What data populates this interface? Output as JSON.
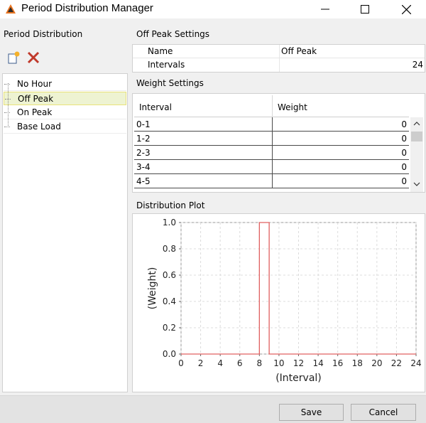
{
  "window": {
    "title": "Period Distribution Manager",
    "controls": [
      "minimize-icon",
      "maximize-icon",
      "close-icon"
    ]
  },
  "left": {
    "section_title": "Period Distribution",
    "toolbar": {
      "add_icon": "new-item-icon",
      "delete_icon": "delete-icon"
    },
    "items": [
      {
        "label": "No Hour",
        "selected": false
      },
      {
        "label": "Off Peak",
        "selected": true
      },
      {
        "label": "On Peak",
        "selected": false
      },
      {
        "label": "Base Load",
        "selected": false
      }
    ]
  },
  "settings": {
    "section_title": "Off Peak Settings",
    "rows": [
      {
        "key": "Name",
        "value": "Off Peak"
      },
      {
        "key": "Intervals",
        "value": "24"
      }
    ]
  },
  "weights": {
    "section_title": "Weight Settings",
    "columns": [
      "Interval",
      "Weight"
    ],
    "rows": [
      {
        "interval": "0-1",
        "weight": "0"
      },
      {
        "interval": "1-2",
        "weight": "0"
      },
      {
        "interval": "2-3",
        "weight": "0"
      },
      {
        "interval": "3-4",
        "weight": "0"
      },
      {
        "interval": "4-5",
        "weight": "0"
      }
    ]
  },
  "plot": {
    "section_title": "Distribution Plot",
    "colors": {
      "series": "#e06060",
      "grid": "#dcdcdc"
    }
  },
  "chart_data": {
    "type": "line",
    "xlabel": "(Interval)",
    "ylabel": "(Weight)",
    "xlim": [
      0,
      24
    ],
    "ylim": [
      0,
      1.0
    ],
    "xticks": [
      0,
      2,
      4,
      6,
      8,
      10,
      12,
      14,
      16,
      18,
      20,
      22,
      24
    ],
    "yticks": [
      0.0,
      0.2,
      0.4,
      0.6,
      0.8,
      1.0
    ],
    "ytick_labels": [
      "0.0",
      "0.2",
      "0.4",
      "0.6",
      "0.8",
      "1.0"
    ],
    "grid": true,
    "series": [
      {
        "x": [
          0,
          8,
          8,
          9,
          9,
          24
        ],
        "y": [
          0,
          0,
          1.0,
          1.0,
          0,
          0
        ]
      }
    ]
  },
  "footer": {
    "save_label": "Save",
    "cancel_label": "Cancel"
  }
}
